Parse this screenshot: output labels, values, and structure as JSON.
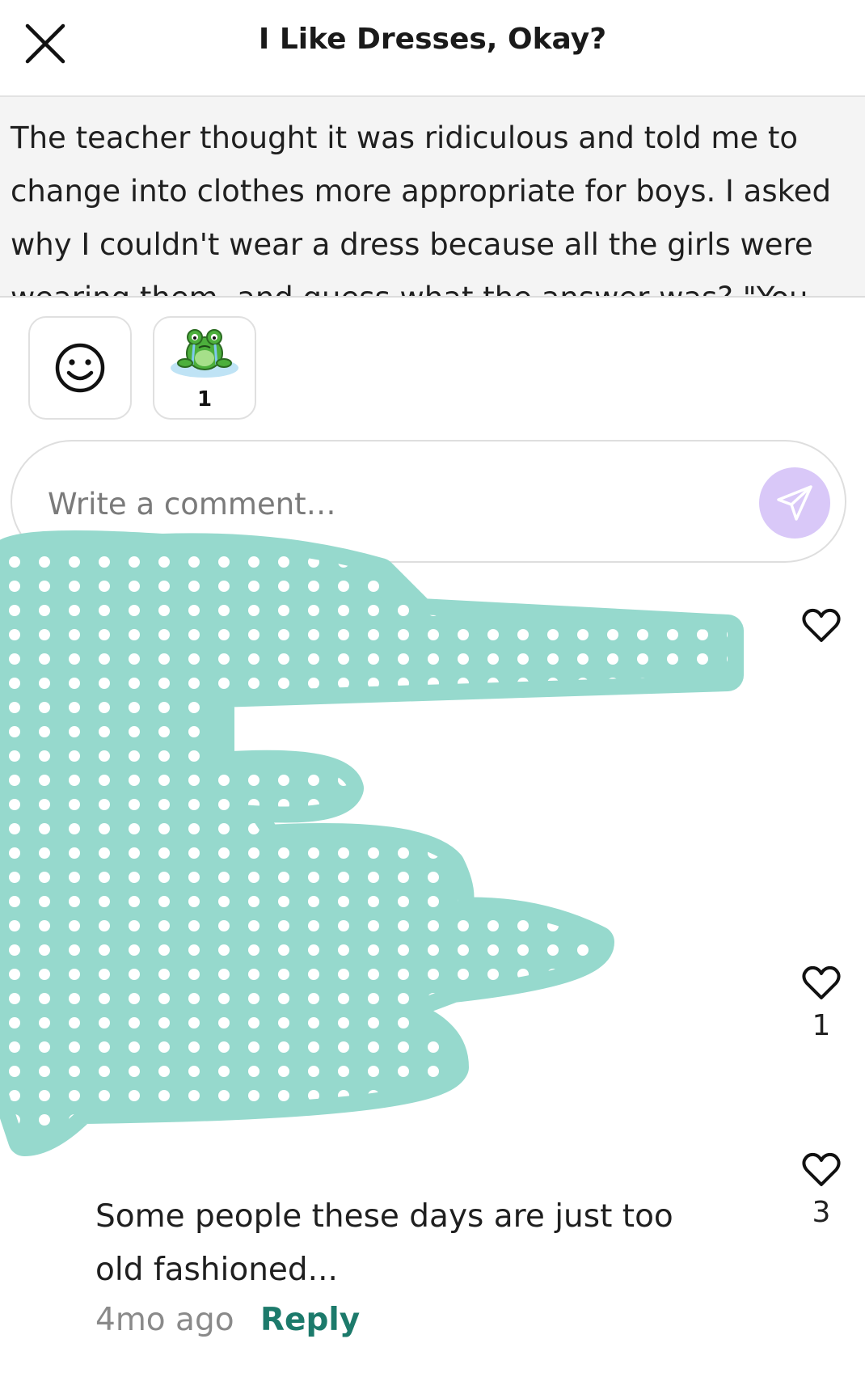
{
  "header": {
    "title": "I Like Dresses, Okay?"
  },
  "story": {
    "excerpt": "The teacher thought it was ridiculous and told me to change into clothes more appropriate for boys. I asked why I couldn't wear a dress because all the girls were wearing them, and guess what the answer was? \"You are"
  },
  "reactions": [
    {
      "icon": "smiley-icon",
      "count": ""
    },
    {
      "icon": "crying-frog-icon",
      "count": "1"
    }
  ],
  "comment_box": {
    "placeholder": "Write a comment…",
    "send_icon": "send-icon"
  },
  "comments": [
    {
      "likes": ""
    },
    {
      "likes": "1"
    },
    {
      "likes": "3",
      "text": "Some people these days are just too old fashioned...",
      "timestamp": "4mo ago",
      "reply_label": "Reply"
    }
  ],
  "colors": {
    "accent": "#1c7a6b",
    "send_button": "#d9c8f8",
    "scribble": "#96d9cd"
  }
}
